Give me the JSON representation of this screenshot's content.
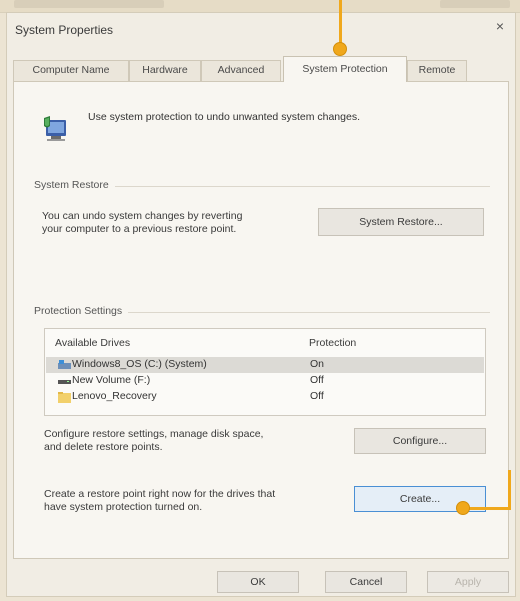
{
  "dialog": {
    "title": "System Properties",
    "close_glyph": "×"
  },
  "tabs": [
    {
      "label": "Computer Name",
      "active": false
    },
    {
      "label": "Hardware",
      "active": false
    },
    {
      "label": "Advanced",
      "active": false
    },
    {
      "label": "System Protection",
      "active": true
    },
    {
      "label": "Remote",
      "active": false
    }
  ],
  "intro": {
    "icon": "system-protection-shield-icon",
    "text": "Use system protection to undo unwanted system changes."
  },
  "system_restore": {
    "group_label": "System Restore",
    "description_line1": "You can undo system changes by reverting",
    "description_line2": "your computer to a previous restore point.",
    "button_label": "System Restore..."
  },
  "protection_settings": {
    "group_label": "Protection Settings",
    "columns": [
      "Available Drives",
      "Protection"
    ],
    "drives": [
      {
        "name": "Windows8_OS (C:) (System)",
        "protection": "On",
        "icon": "system-drive-icon",
        "selected": true
      },
      {
        "name": "New Volume (F:)",
        "protection": "Off",
        "icon": "drive-icon",
        "selected": false
      },
      {
        "name": "Lenovo_Recovery",
        "protection": "Off",
        "icon": "folder-drive-icon",
        "selected": false
      }
    ],
    "configure_line1": "Configure restore settings, manage disk space,",
    "configure_line2": "and delete restore points.",
    "configure_button": "Configure...",
    "create_line1": "Create a restore point right now for the drives that",
    "create_line2": "have system protection turned on.",
    "create_button": "Create..."
  },
  "footer": {
    "ok": "OK",
    "cancel": "Cancel",
    "apply": "Apply"
  },
  "colors": {
    "callout": "#f0a81c",
    "focus_border": "#4a8fd4"
  }
}
